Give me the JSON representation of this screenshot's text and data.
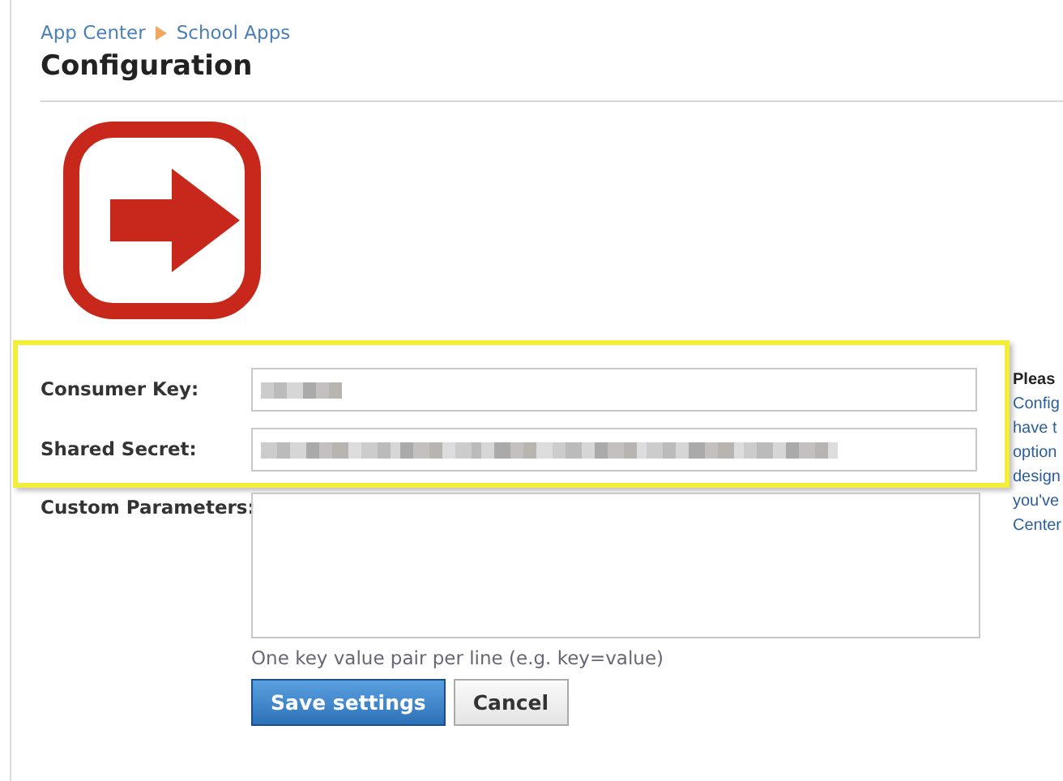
{
  "breadcrumb": [
    {
      "label": "App Center"
    },
    {
      "label": "School Apps"
    }
  ],
  "title": "Configuration",
  "fields": [
    {
      "label": "Consumer Key:",
      "kind": "input",
      "masked": true,
      "highlighted": true
    },
    {
      "label": "Shared Secret:",
      "kind": "input",
      "masked": true,
      "highlighted": true
    },
    {
      "label": "Custom Parameters:",
      "kind": "textarea",
      "masked": false,
      "highlighted": false
    }
  ],
  "hint": "One key value pair per line (e.g. key=value)",
  "buttons": [
    {
      "label": "Save settings",
      "kind": "primary"
    },
    {
      "label": "Cancel",
      "kind": "secondary"
    }
  ],
  "side_note": {
    "heading": "Pleas",
    "lines": [
      "Config",
      "have t",
      "option",
      "design",
      "you've",
      "Center"
    ]
  }
}
